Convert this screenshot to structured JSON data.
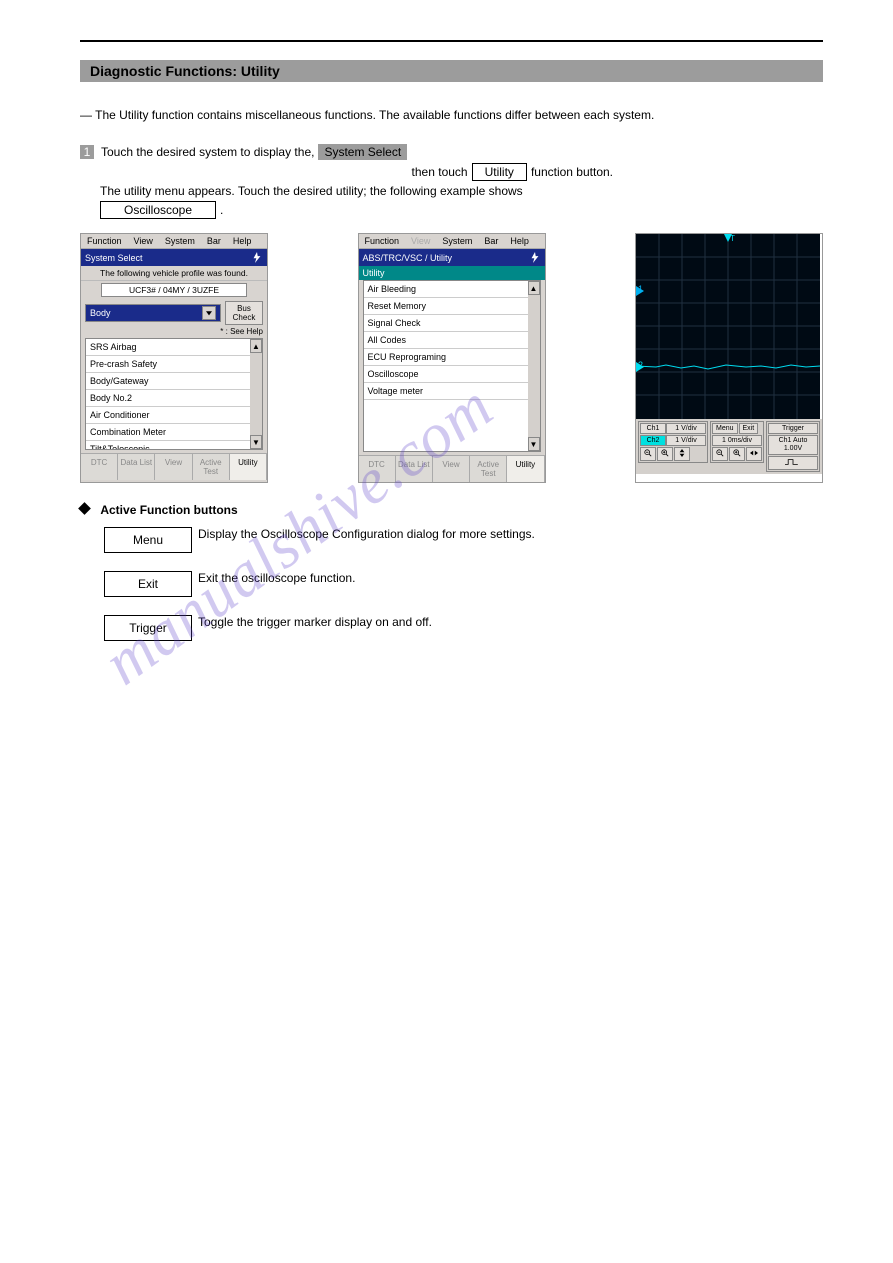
{
  "section_title": "Diagnostic Functions: Utility",
  "intro_prefix": "—",
  "intro_body": "The Utility function contains miscellaneous functions. The available functions differ between each system.",
  "procedure": {
    "num": "1",
    "text": "Touch the desired system to display the, ",
    "btn1": "System Select",
    "after_btn1": " then touch ",
    "btn2": "Utility",
    "after_btn2": " function button.",
    "line2_lead": "The utility menu appears. Touch the desired utility; the following example shows ",
    "btn3": "Oscilloscope",
    "period": "."
  },
  "left_win": {
    "menu": [
      "Function",
      "View",
      "System",
      "Bar",
      "Help"
    ],
    "titlebar": "System Select",
    "profile_line": "The following vehicle profile was found.",
    "vehicle": "UCF3#   / 04MY / 3UZFE",
    "dropdown": "Body",
    "buscheck": "Bus Check",
    "seehelp": "* : See Help",
    "items": [
      "SRS Airbag",
      "Pre-crash Safety",
      "Body/Gateway",
      "Body No.2",
      "Air Conditioner",
      "Combination Meter",
      "Tilt&Telescopic"
    ],
    "tabs": [
      "DTC",
      "Data List",
      "View",
      "Active Test",
      "Utility"
    ]
  },
  "mid_win": {
    "menu": [
      "Function",
      "View",
      "System",
      "Bar",
      "Help"
    ],
    "titlebar": "ABS/TRC/VSC / Utility",
    "utility_label": "Utility",
    "items": [
      "Air Bleeding",
      "Reset Memory",
      "Signal Check",
      "All Codes",
      "ECU Reprograming",
      "Oscilloscope",
      "Voltage meter"
    ],
    "tabs": [
      "DTC",
      "Data List",
      "View",
      "Active Test",
      "Utility"
    ]
  },
  "scope": {
    "ch1": "Ch1",
    "ch2": "Ch2",
    "vdiv": "1 V/div",
    "menu": "Menu",
    "exit": "Exit",
    "trigger": "Trigger",
    "tdiv": "1 0ms/div",
    "trig_info": "Ch1 Auto 1.00V",
    "marker1": "1",
    "marker2": "2"
  },
  "active_buttons": {
    "heading": "Active Function buttons",
    "items": [
      {
        "label": "Menu",
        "desc": "Display the Oscilloscope Configuration dialog for more settings."
      },
      {
        "label": "Exit",
        "desc": "Exit the oscilloscope function."
      },
      {
        "label": "Trigger",
        "desc": "Toggle the trigger marker display on and off."
      }
    ]
  },
  "watermark": "manualshive.com"
}
